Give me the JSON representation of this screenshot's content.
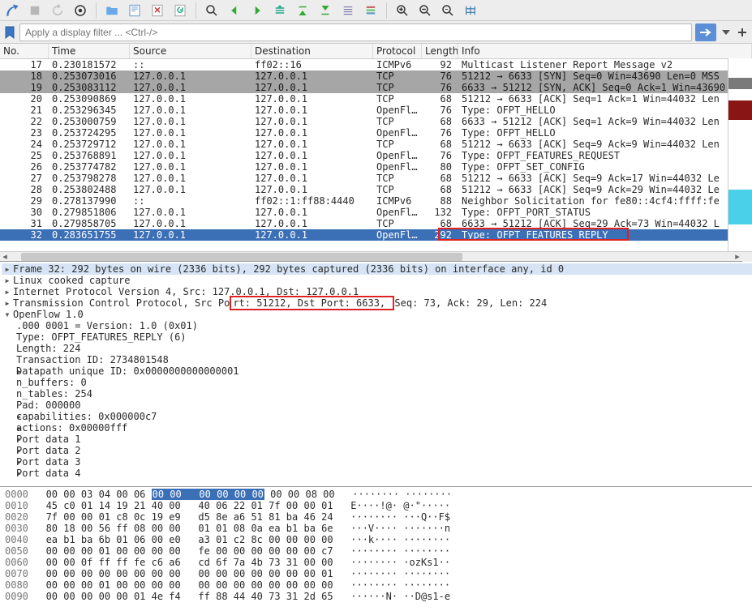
{
  "filter": {
    "placeholder": "Apply a display filter ... <Ctrl-/>"
  },
  "columns": {
    "no": "No.",
    "time": "Time",
    "source": "Source",
    "destination": "Destination",
    "protocol": "Protocol",
    "length": "Length",
    "info": "Info"
  },
  "packets": [
    {
      "no": 17,
      "time": "0.230181572",
      "src": "::",
      "dst": "ff02::16",
      "proto": "ICMPv6",
      "len": 92,
      "info": "Multicast Listener Report Message v2",
      "cls": ""
    },
    {
      "no": 18,
      "time": "0.253073016",
      "src": "127.0.0.1",
      "dst": "127.0.0.1",
      "proto": "TCP",
      "len": 76,
      "info": "51212 → 6633 [SYN] Seq=0 Win=43690 Len=0 MSS",
      "cls": "marked"
    },
    {
      "no": 19,
      "time": "0.253083112",
      "src": "127.0.0.1",
      "dst": "127.0.0.1",
      "proto": "TCP",
      "len": 76,
      "info": "6633 → 51212 [SYN, ACK] Seq=0 Ack=1 Win=43690",
      "cls": "marked"
    },
    {
      "no": 20,
      "time": "0.253090869",
      "src": "127.0.0.1",
      "dst": "127.0.0.1",
      "proto": "TCP",
      "len": 68,
      "info": "51212 → 6633 [ACK] Seq=1 Ack=1 Win=44032 Len",
      "cls": ""
    },
    {
      "no": 21,
      "time": "0.253296345",
      "src": "127.0.0.1",
      "dst": "127.0.0.1",
      "proto": "OpenFl…",
      "len": 76,
      "info": "Type: OFPT_HELLO",
      "cls": ""
    },
    {
      "no": 22,
      "time": "0.253000759",
      "src": "127.0.0.1",
      "dst": "127.0.0.1",
      "proto": "TCP",
      "len": 68,
      "info": "6633 → 51212 [ACK] Seq=1 Ack=9 Win=44032 Len",
      "cls": ""
    },
    {
      "no": 23,
      "time": "0.253724295",
      "src": "127.0.0.1",
      "dst": "127.0.0.1",
      "proto": "OpenFl…",
      "len": 76,
      "info": "Type: OFPT_HELLO",
      "cls": ""
    },
    {
      "no": 24,
      "time": "0.253729712",
      "src": "127.0.0.1",
      "dst": "127.0.0.1",
      "proto": "TCP",
      "len": 68,
      "info": "51212 → 6633 [ACK] Seq=9 Ack=9 Win=44032 Len",
      "cls": ""
    },
    {
      "no": 25,
      "time": "0.253768891",
      "src": "127.0.0.1",
      "dst": "127.0.0.1",
      "proto": "OpenFl…",
      "len": 76,
      "info": "Type: OFPT_FEATURES_REQUEST",
      "cls": ""
    },
    {
      "no": 26,
      "time": "0.253774782",
      "src": "127.0.0.1",
      "dst": "127.0.0.1",
      "proto": "OpenFl…",
      "len": 80,
      "info": "Type: OFPT_SET_CONFIG",
      "cls": ""
    },
    {
      "no": 27,
      "time": "0.253798278",
      "src": "127.0.0.1",
      "dst": "127.0.0.1",
      "proto": "TCP",
      "len": 68,
      "info": "51212 → 6633 [ACK] Seq=9 Ack=17 Win=44032 Le",
      "cls": ""
    },
    {
      "no": 28,
      "time": "0.253802488",
      "src": "127.0.0.1",
      "dst": "127.0.0.1",
      "proto": "TCP",
      "len": 68,
      "info": "51212 → 6633 [ACK] Seq=9 Ack=29 Win=44032 Le",
      "cls": ""
    },
    {
      "no": 29,
      "time": "0.278137990",
      "src": "::",
      "dst": "ff02::1:ff88:4440",
      "proto": "ICMPv6",
      "len": 88,
      "info": "Neighbor Solicitation for fe80::4cf4:ffff:fe",
      "cls": ""
    },
    {
      "no": 30,
      "time": "0.279851806",
      "src": "127.0.0.1",
      "dst": "127.0.0.1",
      "proto": "OpenFl…",
      "len": 132,
      "info": "Type: OFPT_PORT_STATUS",
      "cls": ""
    },
    {
      "no": 31,
      "time": "0.279858705",
      "src": "127.0.0.1",
      "dst": "127.0.0.1",
      "proto": "TCP",
      "len": 68,
      "info": "6633 → 51212 [ACK] Seq=29 Ack=73 Win=44032 L",
      "cls": ""
    },
    {
      "no": 32,
      "time": "0.283651755",
      "src": "127.0.0.1",
      "dst": "127.0.0.1",
      "proto": "OpenFl…",
      "len": 292,
      "info": "Type: OFPT_FEATURES_REPLY",
      "cls": "selected"
    }
  ],
  "details": {
    "frame": "Frame 32: 292 bytes on wire (2336 bits), 292 bytes captured (2336 bits) on interface any, id 0",
    "cooked": "Linux cooked capture",
    "ip": "Internet Protocol Version 4, Src: 127.0.0.1, Dst: 127.0.0.1",
    "tcp_pre": "Transmission Control Protocol, Src Po",
    "tcp_box": "rt: 51212, Dst Port: 6633, ",
    "tcp_post": "Seq: 73, Ack: 29, Len: 224",
    "of": "OpenFlow 1.0",
    "lines": [
      ".000 0001 = Version: 1.0 (0x01)",
      "Type: OFPT_FEATURES_REPLY (6)",
      "Length: 224",
      "Transaction ID: 2734801548",
      "Datapath unique ID: 0x0000000000000001",
      "n_buffers: 0",
      "n_tables: 254",
      "Pad: 000000",
      "capabilities: 0x000000c7",
      "actions: 0x00000fff",
      "Port data 1",
      "Port data 2",
      "Port data 3",
      "Port data 4"
    ],
    "expandable": [
      4,
      8,
      9,
      10,
      11,
      12,
      13
    ]
  },
  "hex": {
    "rows": [
      {
        "off": "0000",
        "b1": "00 00 03 04 00 06 ",
        "sel": "00 00   00 00 00 00",
        "b2": " 00 00 08 00",
        "a": "   ········ ········"
      },
      {
        "off": "0010",
        "b1": "45 c0 01 14 19 21 40 00   40 06 22 01 7f 00 00 01",
        "a": "   E····!@· @·\"·····"
      },
      {
        "off": "0020",
        "b1": "7f 00 00 01 c8 0c 19 e9   d5 8e a6 51 81 ba 46 24",
        "a": "   ········ ···Q··F$"
      },
      {
        "off": "0030",
        "b1": "80 18 00 56 ff 08 00 00   01 01 08 0a ea b1 ba 6e",
        "a": "   ···V···· ·······n"
      },
      {
        "off": "0040",
        "b1": "ea b1 ba 6b 01 06 00 e0   a3 01 c2 8c 00 00 00 00",
        "a": "   ···k···· ········"
      },
      {
        "off": "0050",
        "b1": "00 00 00 01 00 00 00 00   fe 00 00 00 00 00 00 c7",
        "a": "   ········ ········"
      },
      {
        "off": "0060",
        "b1": "00 00 0f ff ff fe c6 a6   cd 6f 7a 4b 73 31 00 00",
        "a": "   ········ ·ozKs1··"
      },
      {
        "off": "0070",
        "b1": "00 00 00 00 00 00 00 00   00 00 00 00 00 00 00 01",
        "a": "   ········ ········"
      },
      {
        "off": "0080",
        "b1": "00 00 00 01 00 00 00 00   00 00 00 00 00 00 00 00",
        "a": "   ········ ········"
      },
      {
        "off": "0090",
        "b1": "00 00 00 00 00 01 4e f4   ff 88 44 40 73 31 2d 65",
        "a": "   ······N· ··D@s1-e"
      }
    ]
  }
}
